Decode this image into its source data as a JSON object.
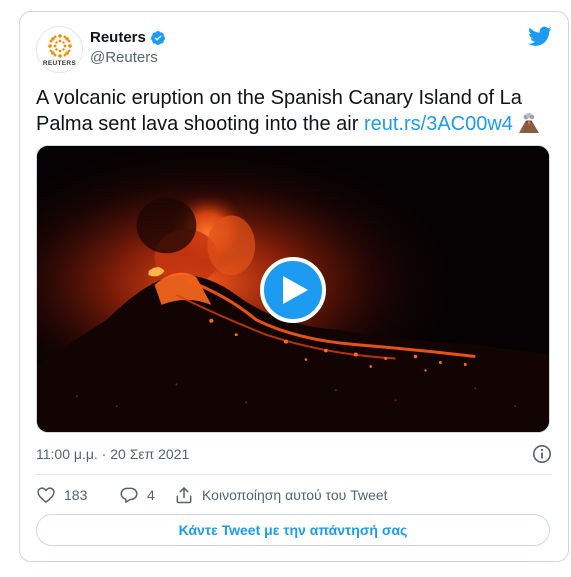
{
  "author": {
    "name": "Reuters",
    "handle": "@Reuters",
    "avatar_wordmark": "REUTERS",
    "verified": true
  },
  "tweet": {
    "text": "A volcanic eruption on the Spanish Canary Island of La Palma sent lava shooting into the air ",
    "link": "reut.rs/3AC00w4",
    "emoji": "volcano-emoji"
  },
  "media": {
    "type": "video",
    "play_icon": "play-icon"
  },
  "meta": {
    "timestamp": "11:00 μ.μ. · 20 Σεπ 2021",
    "info_icon": "info-icon"
  },
  "actions": {
    "like_count": "183",
    "reply_count": "4",
    "share_label": "Κοινοποίηση αυτού του Tweet"
  },
  "reply_button_label": "Κάντε Tweet με την απάντησή σας",
  "colors": {
    "accent": "#1d9bf0",
    "text": "#0f1419",
    "muted": "#536471",
    "border": "#cfd9de"
  }
}
